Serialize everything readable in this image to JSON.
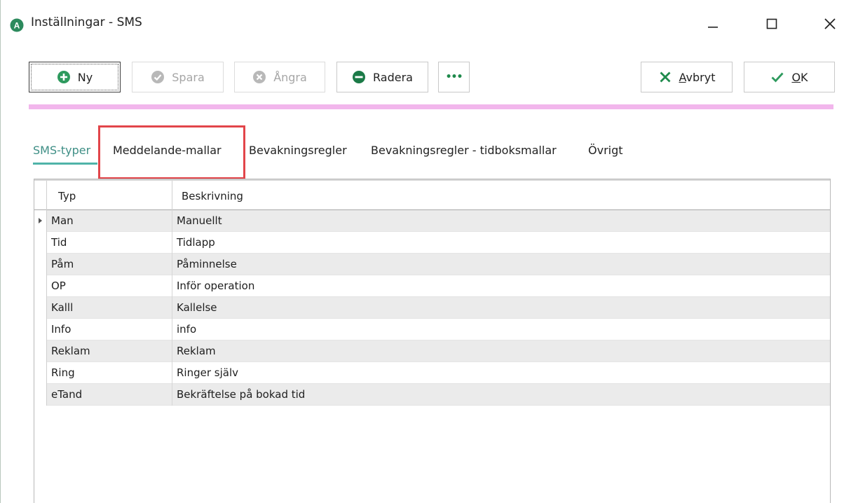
{
  "window": {
    "title": "Inställningar - SMS"
  },
  "toolbar": {
    "new_label": "Ny",
    "save_label": "Spara",
    "undo_label": "Ångra",
    "delete_label": "Radera",
    "more_label": "•••",
    "cancel_label_first": "A",
    "cancel_label_rest": "vbryt",
    "ok_label_first": "O",
    "ok_label_rest": "K"
  },
  "tabs": [
    {
      "label": "SMS-typer",
      "active": true
    },
    {
      "label": "Meddelande-mallar",
      "active": false
    },
    {
      "label": "Bevakningsregler",
      "active": false
    },
    {
      "label": "Bevakningsregler - tidboksmallar",
      "active": false
    },
    {
      "label": "Övrigt",
      "active": false
    }
  ],
  "grid": {
    "columns": [
      "Typ",
      "Beskrivning"
    ],
    "rows": [
      {
        "typ": "Man",
        "beskrivning": "Manuellt",
        "current": true
      },
      {
        "typ": "Tid",
        "beskrivning": "Tidlapp"
      },
      {
        "typ": "Påm",
        "beskrivning": "Påminnelse"
      },
      {
        "typ": "OP",
        "beskrivning": "Inför operation"
      },
      {
        "typ": "Kalll",
        "beskrivning": "Kallelse"
      },
      {
        "typ": "Info",
        "beskrivning": "info"
      },
      {
        "typ": "Reklam",
        "beskrivning": "Reklam"
      },
      {
        "typ": "Ring",
        "beskrivning": "Ringer själv"
      },
      {
        "typ": "eTand",
        "beskrivning": "Bekräftelse på bokad tid"
      }
    ]
  },
  "colors": {
    "accent_teal": "#4fb3a8",
    "pink_bar": "#f2b6ec",
    "highlight_red": "#e2454a",
    "ok_green": "#2e9a5e",
    "cancel_green": "#1f8a4c"
  },
  "icons": {
    "app": "app-logo-icon",
    "new": "plus-circle-icon",
    "save": "check-circle-icon",
    "undo": "x-circle-icon",
    "delete": "minus-circle-icon",
    "more": "more-dots-icon",
    "cancel": "x-icon",
    "ok": "check-icon"
  }
}
